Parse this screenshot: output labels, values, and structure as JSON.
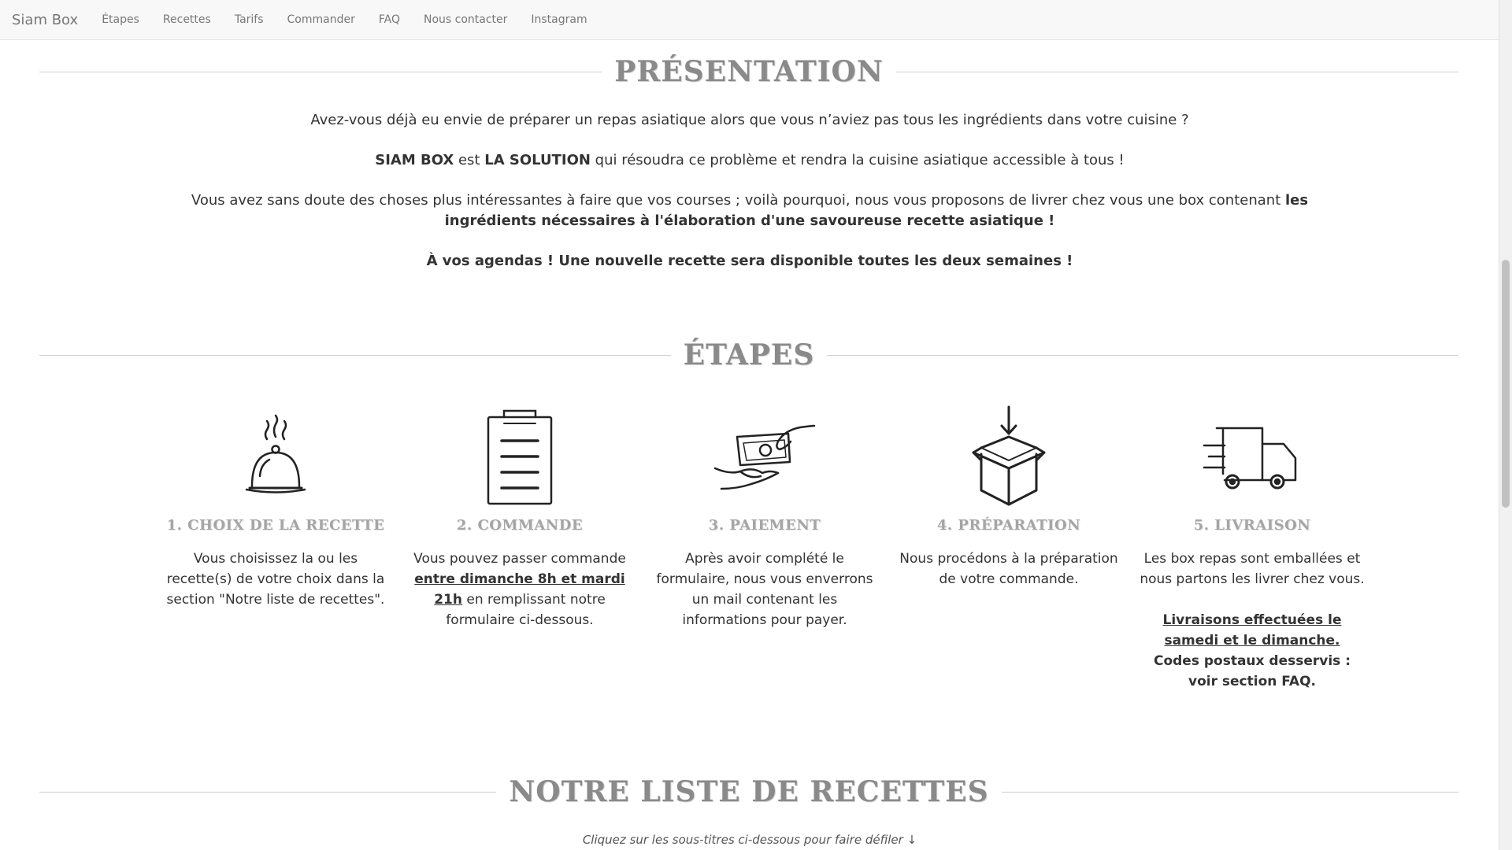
{
  "nav": {
    "brand": "Siam Box",
    "links": [
      "Étapes",
      "Recettes",
      "Tarifs",
      "Commander",
      "FAQ",
      "Nous contacter",
      "Instagram"
    ]
  },
  "presentation": {
    "title": "PRÉSENTATION",
    "p1": "Avez-vous déjà eu envie de préparer un repas asiatique alors que vous n’aviez pas tous les ingrédients dans votre cuisine ?",
    "p2_a": "SIAM BOX",
    "p2_b": " est ",
    "p2_c": "LA SOLUTION",
    "p2_d": " qui résoudra ce problème et rendra la cuisine asiatique accessible à tous !",
    "p3_a": "Vous avez sans doute des choses plus intéressantes à faire que vos courses ; voilà pourquoi, nous vous proposons de livrer chez vous une box contenant ",
    "p3_b": "les ingrédients nécessaires à l'élaboration d'une savoureuse recette asiatique !",
    "p4": "À vos agendas ! Une nouvelle recette sera disponible toutes les deux semaines !"
  },
  "etapes": {
    "title": "ÉTAPES",
    "steps": [
      {
        "icon": "cloche-icon",
        "title": "1. CHOIX DE LA RECETTE",
        "desc": "Vous choisissez la ou les recette(s) de votre choix dans la section \"Notre liste de recettes\"."
      },
      {
        "icon": "clipboard-icon",
        "title": "2. COMMANDE",
        "desc_a": "Vous pouvez passer commande ",
        "desc_b": "entre dimanche 8h et mardi 21h",
        "desc_c": " en remplissant notre formulaire ci-dessous."
      },
      {
        "icon": "payment-icon",
        "title": "3. PAIEMENT",
        "desc": "Après avoir complété le formulaire, nous vous enverrons un mail contenant les informations pour payer."
      },
      {
        "icon": "box-icon",
        "title": "4. PRÉPARATION",
        "desc": "Nous procédons à la préparation de votre commande."
      },
      {
        "icon": "truck-icon",
        "title": "5. LIVRAISON",
        "desc": "Les box repas sont emballées et nous partons les livrer chez vous.",
        "link": "Livraisons effectuées le samedi et le dimanche.",
        "desc2": "Codes postaux desservis : voir section FAQ."
      }
    ]
  },
  "recettes": {
    "title": "NOTRE LISTE DE RECETTES",
    "hint": "Cliquez sur les sous-titres ci-dessous pour faire défiler ↓"
  }
}
